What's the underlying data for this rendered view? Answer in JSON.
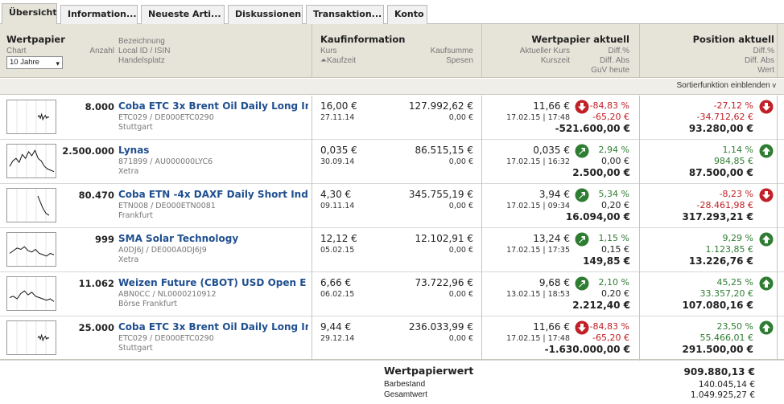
{
  "tabs": [
    {
      "label": "Übersicht",
      "active": true
    },
    {
      "label": "Information...",
      "active": false
    },
    {
      "label": "Neueste Arti...",
      "active": false
    },
    {
      "label": "Diskussionen",
      "active": false
    },
    {
      "label": "Transaktion...",
      "active": false
    },
    {
      "label": "Konto",
      "active": false
    }
  ],
  "header": {
    "wertpapier": {
      "title": "Wertpapier",
      "chart_label": "Chart",
      "anzahl_label": "Anzahl",
      "bezeichnung": "Bezeichnung",
      "local_id": "Local ID / ISIN",
      "handelsplatz": "Handelsplatz",
      "range_selected": "10 Jahre"
    },
    "kaufinfo": {
      "title": "Kaufinformation",
      "kurs": "Kurs",
      "kaufzeit": "Kaufzeit",
      "kaufsumme": "Kaufsumme",
      "spesen": "Spesen"
    },
    "aktuell": {
      "title": "Wertpapier aktuell",
      "aktueller_kurs": "Aktueller Kurs",
      "kurszeit": "Kurszeit",
      "diff_pct": "Diff.%",
      "diff_abs": "Diff. Abs",
      "guv_heute": "GuV heute"
    },
    "position": {
      "title": "Position aktuell",
      "diff_pct": "Diff.%",
      "diff_abs": "Diff. Abs",
      "wert": "Wert"
    }
  },
  "sort_toggle": "Sortierfunktion einblenden",
  "sort_icon": "chevron-down-icon",
  "colors": {
    "accent_link": "#1f4f8f",
    "negative": "#c02026",
    "positive": "#2e7d32",
    "header_bg": "#e6e4d9"
  },
  "rows": [
    {
      "anzahl": "8.000",
      "name": "Coba ETC 3x Brent Oil Daily Long In",
      "id": "ETC029 / DE000ETC0290",
      "place": "Stuttgart",
      "kurs": "16,00 €",
      "kaufzeit": "27.11.14",
      "kaufsumme": "127.992,62 €",
      "spesen": "0,00 €",
      "akt_kurs": "11,66 €",
      "kurszeit": "17.02.15 | 17:48",
      "akt_dir": "down",
      "akt_pct": "-84,83 %",
      "akt_abs": "-65,20 €",
      "guv": "-521.600,00 €",
      "pos_pct": "-27,12 %",
      "pos_abs": "-34.712,62 €",
      "pos_wert": "93.280,00 €",
      "pos_dir": "down",
      "spark": [
        0.5,
        0.55,
        0.45,
        0.6,
        0.4,
        0.5,
        0.55,
        0.45,
        0.5,
        0.48
      ]
    },
    {
      "anzahl": "2.500.000",
      "name": "Lynas",
      "id": "871899 / AU000000LYC6",
      "place": "Xetra",
      "kurs": "0,035 €",
      "kaufzeit": "30.09.14",
      "kaufsumme": "86.515,15 €",
      "spesen": "0,00 €",
      "akt_kurs": "0,035 €",
      "kurszeit": "17.02.15 | 16:32",
      "akt_dir": "up",
      "akt_pct": "2,94 %",
      "akt_abs": "0,00 €",
      "guv": "2.500,00 €",
      "pos_pct": "1,14 %",
      "pos_abs": "984,85 €",
      "pos_wert": "87.500,00 €",
      "pos_dir": "up",
      "spark": [
        0.3,
        0.5,
        0.6,
        0.45,
        0.75,
        0.6,
        0.85,
        0.7,
        0.9,
        0.6,
        0.5,
        0.3,
        0.2,
        0.15,
        0.1
      ]
    },
    {
      "anzahl": "80.470",
      "name": "Coba ETN -4x DAXF Daily Short Ind",
      "id": "ETN008 / DE000ETN0081",
      "place": "Frankfurt",
      "kurs": "4,30 €",
      "kaufzeit": "09.11.14",
      "kaufsumme": "345.755,19 €",
      "spesen": "0,00 €",
      "akt_kurs": "3,94 €",
      "kurszeit": "17.02.15 | 09:34",
      "akt_dir": "up",
      "akt_pct": "5,34 %",
      "akt_abs": "0,20 €",
      "guv": "16.094,00 €",
      "pos_pct": "-8,23 %",
      "pos_abs": "-28.461,98 €",
      "pos_wert": "317.293,21 €",
      "pos_dir": "down",
      "spark": [
        0.85,
        0.7,
        0.55,
        0.4,
        0.3,
        0.2,
        0.15,
        0.12
      ]
    },
    {
      "anzahl": "999",
      "name": "SMA Solar Technology",
      "id": "A0DJ6J / DE000A0DJ6J9",
      "place": "Xetra",
      "kurs": "12,12 €",
      "kaufzeit": "05.02.15",
      "kaufsumme": "12.102,91 €",
      "spesen": "0,00 €",
      "akt_kurs": "13,24 €",
      "kurszeit": "17.02.15 | 17:35",
      "akt_dir": "up",
      "akt_pct": "1,15 %",
      "akt_abs": "0,15 €",
      "guv": "149,85 €",
      "pos_pct": "9,29 %",
      "pos_abs": "1.123,85 €",
      "pos_wert": "13.226,76 €",
      "pos_dir": "up",
      "spark": [
        0.35,
        0.45,
        0.55,
        0.5,
        0.6,
        0.45,
        0.4,
        0.5,
        0.35,
        0.3,
        0.25,
        0.35,
        0.3
      ]
    },
    {
      "anzahl": "11.062",
      "name": "Weizen Future (CBOT) USD Open E",
      "id": "ABN0CC / NL0000210912",
      "place": "Börse Frankfurt",
      "kurs": "6,66 €",
      "kaufzeit": "06.02.15",
      "kaufsumme": "73.722,96 €",
      "spesen": "0,00 €",
      "akt_kurs": "9,68 €",
      "kurszeit": "13.02.15 | 18:53",
      "akt_dir": "up",
      "akt_pct": "2,10 %",
      "akt_abs": "0,20 €",
      "guv": "2.212,40 €",
      "pos_pct": "45,25 %",
      "pos_abs": "33.357,20 €",
      "pos_wert": "107.080,16 €",
      "pos_dir": "up",
      "spark": [
        0.35,
        0.4,
        0.3,
        0.5,
        0.6,
        0.45,
        0.55,
        0.4,
        0.35,
        0.3,
        0.25,
        0.3,
        0.2
      ]
    },
    {
      "anzahl": "25.000",
      "name": "Coba ETC 3x Brent Oil Daily Long In",
      "id": "ETC029 / DE000ETC0290",
      "place": "Stuttgart",
      "kurs": "9,44 €",
      "kaufzeit": "29.12.14",
      "kaufsumme": "236.033,99 €",
      "spesen": "0,00 €",
      "akt_kurs": "11,66 €",
      "kurszeit": "17.02.15 | 17:48",
      "akt_dir": "down",
      "akt_pct": "-84,83 %",
      "akt_abs": "-65,20 €",
      "guv": "-1.630.000,00 €",
      "pos_pct": "23,50 %",
      "pos_abs": "55.466,01 €",
      "pos_wert": "291.500,00 €",
      "pos_dir": "up",
      "spark": [
        0.5,
        0.55,
        0.45,
        0.6,
        0.4,
        0.5,
        0.55,
        0.45,
        0.5,
        0.48
      ]
    }
  ],
  "footer": {
    "wertpapierwert_label": "Wertpapierwert",
    "wertpapierwert": "909.880,13 €",
    "barbestand_label": "Barbestand",
    "barbestand": "140.045,14 €",
    "gesamtwert_label": "Gesamtwert",
    "gesamtwert": "1.049.925,27 €"
  }
}
